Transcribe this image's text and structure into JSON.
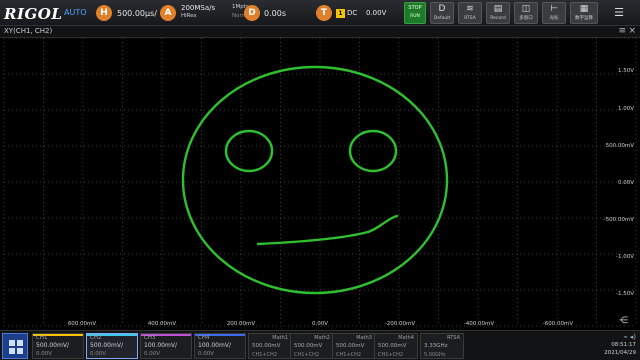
{
  "toolbar": {
    "brand": "RIGOL",
    "mode": "AUTO",
    "horiz_badge": "H",
    "timebase": "500.00µs/",
    "acq_badge": "A",
    "sample_rate": "200MSa/s",
    "acq_mode": "HiRes",
    "acq_mode_sub": "Normal",
    "mem_depth": "1Mpts",
    "delay_badge": "D",
    "delay": "0.00s",
    "trig_badge": "T",
    "trig_ch": "1",
    "trig_coupling": "DC",
    "trig_level": "0.00V",
    "buttons": [
      {
        "icon": "stop-icon",
        "label": "STOP",
        "sub": "RUN"
      },
      {
        "icon": "d-auto-icon",
        "label": "D",
        "sub": "Default"
      },
      {
        "icon": "rtsa-icon",
        "label": "RTSA",
        "sub": ""
      },
      {
        "icon": "record-icon",
        "label": "",
        "sub": "Record"
      },
      {
        "icon": "measure-icon",
        "label": "",
        "sub": "多窗口"
      },
      {
        "icon": "ruler-icon",
        "label": "",
        "sub": "光标"
      },
      {
        "icon": "calc-icon",
        "label": "",
        "sub": "数字运算"
      }
    ]
  },
  "window": {
    "title": "XY(CH1, CH2)",
    "y_ticks": [
      "1.50V",
      "1.00V",
      "500.00mV",
      "0.00V",
      "-500.00mV",
      "-1.00V",
      "-1.50V"
    ],
    "x_ticks": [
      "600.00mV",
      "400.00mV",
      "200.00mV",
      "0.00V",
      "-200.00mV",
      "-400.00mV",
      "-600.00mV"
    ]
  },
  "channels": [
    {
      "name": "CH1",
      "scale": "500.00mV/",
      "offset": "0.00V",
      "color": "#f5c400",
      "active": false
    },
    {
      "name": "CH2",
      "scale": "500.00mV/",
      "offset": "0.00V",
      "color": "#3ec8e6",
      "active": true
    },
    {
      "name": "CH3",
      "scale": "100.00mV/",
      "offset": "0.00V",
      "color": "#c050d8",
      "active": false
    },
    {
      "name": "CH4",
      "scale": "100.00mV/",
      "offset": "0.00V",
      "color": "#3a6cf0",
      "active": false
    }
  ],
  "math": [
    {
      "name": "Math1",
      "value": "500.00mV",
      "expr": "CH1+CH2"
    },
    {
      "name": "Math2",
      "value": "500.00mV",
      "expr": "CH1+CH2"
    },
    {
      "name": "Math3",
      "value": "500.00mV",
      "expr": "CH1+CH2"
    },
    {
      "name": "Math4",
      "value": "500.00mV",
      "expr": "CH1+CH2"
    }
  ],
  "rtsa": {
    "name": "RTSA",
    "freq": "3.33GHz",
    "span": "5.00GHz"
  },
  "status": {
    "time": "08:51:17",
    "date": "2021/04/29"
  },
  "colors": {
    "trace": "#2fc02f",
    "grid": "#4a4a4a",
    "accent": "#1d3f8a"
  }
}
